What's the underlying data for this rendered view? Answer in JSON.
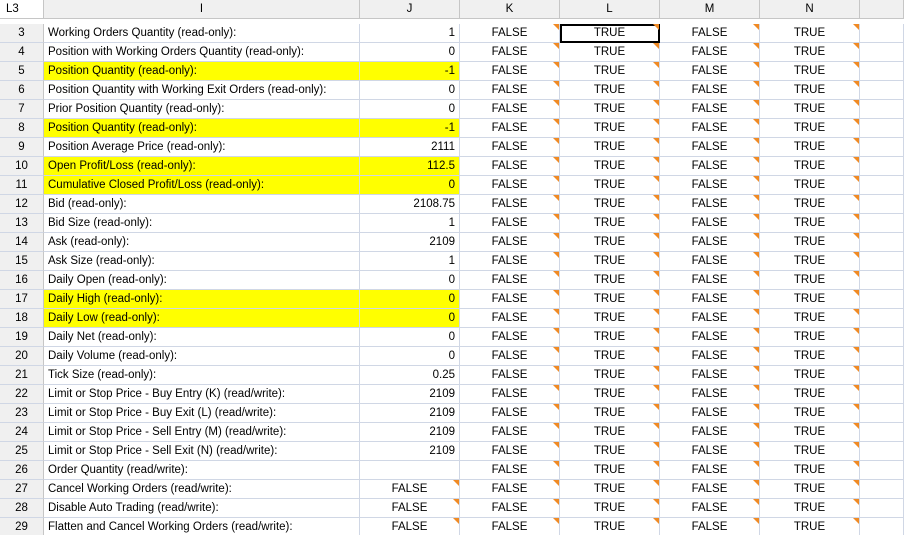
{
  "name_box": "L3",
  "columns": [
    "I",
    "J",
    "K",
    "L",
    "M",
    "N"
  ],
  "rows": [
    {
      "num": "3",
      "label": "Working Orders Quantity (read-only):",
      "j": "1",
      "k": "FALSE",
      "l": "TRUE",
      "m": "FALSE",
      "n": "TRUE",
      "hl": false,
      "jbool": false
    },
    {
      "num": "4",
      "label": "Position with Working Orders Quantity (read-only):",
      "j": "0",
      "k": "FALSE",
      "l": "TRUE",
      "m": "FALSE",
      "n": "TRUE",
      "hl": false,
      "jbool": false
    },
    {
      "num": "5",
      "label": "Position Quantity (read-only):",
      "j": "-1",
      "k": "FALSE",
      "l": "TRUE",
      "m": "FALSE",
      "n": "TRUE",
      "hl": true,
      "jbool": false
    },
    {
      "num": "6",
      "label": "Position Quantity with Working Exit Orders (read-only):",
      "j": "0",
      "k": "FALSE",
      "l": "TRUE",
      "m": "FALSE",
      "n": "TRUE",
      "hl": false,
      "jbool": false
    },
    {
      "num": "7",
      "label": "Prior Position Quantity (read-only):",
      "j": "0",
      "k": "FALSE",
      "l": "TRUE",
      "m": "FALSE",
      "n": "TRUE",
      "hl": false,
      "jbool": false
    },
    {
      "num": "8",
      "label": "Position Quantity (read-only):",
      "j": "-1",
      "k": "FALSE",
      "l": "TRUE",
      "m": "FALSE",
      "n": "TRUE",
      "hl": true,
      "jbool": false
    },
    {
      "num": "9",
      "label": "Position Average Price (read-only):",
      "j": "2111",
      "k": "FALSE",
      "l": "TRUE",
      "m": "FALSE",
      "n": "TRUE",
      "hl": false,
      "jbool": false
    },
    {
      "num": "10",
      "label": "Open Profit/Loss (read-only):",
      "j": "112.5",
      "k": "FALSE",
      "l": "TRUE",
      "m": "FALSE",
      "n": "TRUE",
      "hl": true,
      "jbool": false
    },
    {
      "num": "11",
      "label": "Cumulative Closed Profit/Loss (read-only):",
      "j": "0",
      "k": "FALSE",
      "l": "TRUE",
      "m": "FALSE",
      "n": "TRUE",
      "hl": true,
      "jbool": false
    },
    {
      "num": "12",
      "label": "Bid (read-only):",
      "j": "2108.75",
      "k": "FALSE",
      "l": "TRUE",
      "m": "FALSE",
      "n": "TRUE",
      "hl": false,
      "jbool": false
    },
    {
      "num": "13",
      "label": "Bid Size (read-only):",
      "j": "1",
      "k": "FALSE",
      "l": "TRUE",
      "m": "FALSE",
      "n": "TRUE",
      "hl": false,
      "jbool": false
    },
    {
      "num": "14",
      "label": "Ask (read-only):",
      "j": "2109",
      "k": "FALSE",
      "l": "TRUE",
      "m": "FALSE",
      "n": "TRUE",
      "hl": false,
      "jbool": false
    },
    {
      "num": "15",
      "label": "Ask Size (read-only):",
      "j": "1",
      "k": "FALSE",
      "l": "TRUE",
      "m": "FALSE",
      "n": "TRUE",
      "hl": false,
      "jbool": false
    },
    {
      "num": "16",
      "label": "Daily Open (read-only):",
      "j": "0",
      "k": "FALSE",
      "l": "TRUE",
      "m": "FALSE",
      "n": "TRUE",
      "hl": false,
      "jbool": false
    },
    {
      "num": "17",
      "label": "Daily High (read-only):",
      "j": "0",
      "k": "FALSE",
      "l": "TRUE",
      "m": "FALSE",
      "n": "TRUE",
      "hl": true,
      "jbool": false
    },
    {
      "num": "18",
      "label": "Daily Low (read-only):",
      "j": "0",
      "k": "FALSE",
      "l": "TRUE",
      "m": "FALSE",
      "n": "TRUE",
      "hl": true,
      "jbool": false
    },
    {
      "num": "19",
      "label": "Daily Net (read-only):",
      "j": "0",
      "k": "FALSE",
      "l": "TRUE",
      "m": "FALSE",
      "n": "TRUE",
      "hl": false,
      "jbool": false
    },
    {
      "num": "20",
      "label": "Daily Volume (read-only):",
      "j": "0",
      "k": "FALSE",
      "l": "TRUE",
      "m": "FALSE",
      "n": "TRUE",
      "hl": false,
      "jbool": false
    },
    {
      "num": "21",
      "label": "Tick Size (read-only):",
      "j": "0.25",
      "k": "FALSE",
      "l": "TRUE",
      "m": "FALSE",
      "n": "TRUE",
      "hl": false,
      "jbool": false
    },
    {
      "num": "22",
      "label": "Limit or Stop Price - Buy Entry (K) (read/write):",
      "j": "2109",
      "k": "FALSE",
      "l": "TRUE",
      "m": "FALSE",
      "n": "TRUE",
      "hl": false,
      "jbool": false
    },
    {
      "num": "23",
      "label": "Limit or Stop Price - Buy Exit (L) (read/write):",
      "j": "2109",
      "k": "FALSE",
      "l": "TRUE",
      "m": "FALSE",
      "n": "TRUE",
      "hl": false,
      "jbool": false
    },
    {
      "num": "24",
      "label": "Limit or Stop Price - Sell Entry (M) (read/write):",
      "j": "2109",
      "k": "FALSE",
      "l": "TRUE",
      "m": "FALSE",
      "n": "TRUE",
      "hl": false,
      "jbool": false
    },
    {
      "num": "25",
      "label": "Limit or Stop Price - Sell Exit (N) (read/write):",
      "j": "2109",
      "k": "FALSE",
      "l": "TRUE",
      "m": "FALSE",
      "n": "TRUE",
      "hl": false,
      "jbool": false
    },
    {
      "num": "26",
      "label": "Order Quantity (read/write):",
      "j": "",
      "k": "FALSE",
      "l": "TRUE",
      "m": "FALSE",
      "n": "TRUE",
      "hl": false,
      "jbool": false
    },
    {
      "num": "27",
      "label": "Cancel Working Orders (read/write):",
      "j": "FALSE",
      "k": "FALSE",
      "l": "TRUE",
      "m": "FALSE",
      "n": "TRUE",
      "hl": false,
      "jbool": true
    },
    {
      "num": "28",
      "label": "Disable Auto Trading (read/write):",
      "j": "FALSE",
      "k": "FALSE",
      "l": "TRUE",
      "m": "FALSE",
      "n": "TRUE",
      "hl": false,
      "jbool": true
    },
    {
      "num": "29",
      "label": "Flatten and Cancel Working Orders (read/write):",
      "j": "FALSE",
      "k": "FALSE",
      "l": "TRUE",
      "m": "FALSE",
      "n": "TRUE",
      "hl": false,
      "jbool": true
    }
  ],
  "selected_cell": "L3",
  "colors": {
    "highlight": "#ffff00",
    "comment_marker": "#f08a24",
    "header_bg": "#f0f0f0",
    "grid": "#d0d7e5"
  }
}
